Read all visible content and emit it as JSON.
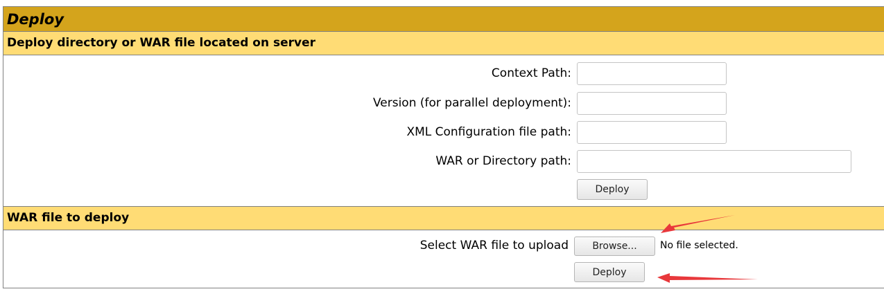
{
  "header": {
    "title": "Deploy"
  },
  "server_section": {
    "heading": "Deploy directory or WAR file located on server",
    "fields": [
      {
        "label": "Context Path:",
        "value": ""
      },
      {
        "label": "Version (for parallel deployment):",
        "value": ""
      },
      {
        "label": "XML Configuration file path:",
        "value": ""
      },
      {
        "label": "WAR or Directory path:",
        "value": ""
      }
    ],
    "deploy_label": "Deploy"
  },
  "upload_section": {
    "heading": "WAR file to deploy",
    "file_label": "Select WAR file to upload",
    "browse_label": "Browse...",
    "file_status": "No file selected.",
    "deploy_label": "Deploy"
  },
  "annotation_color": "#e8383b"
}
